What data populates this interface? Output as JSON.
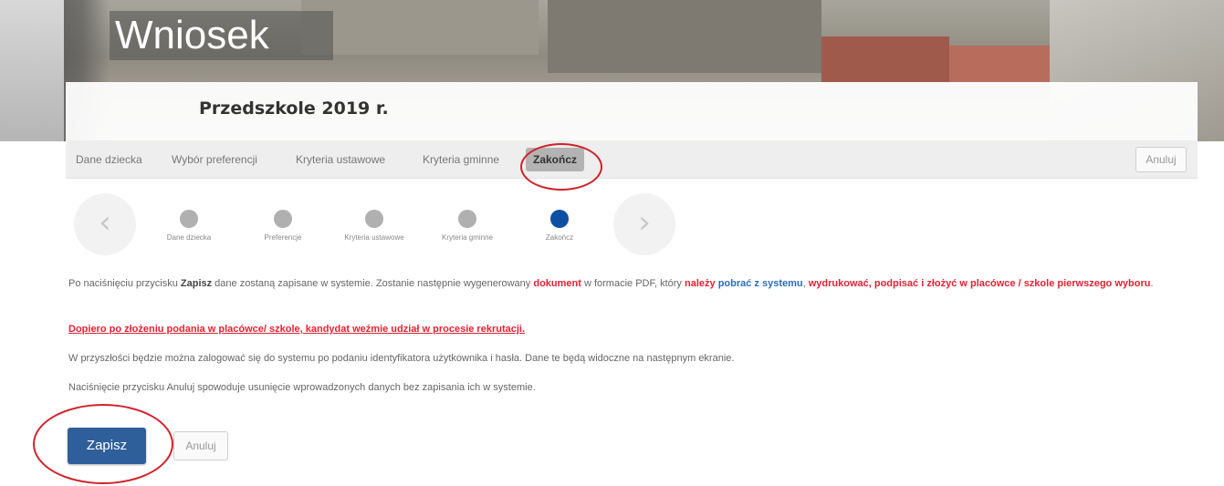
{
  "header": {
    "title": "Wniosek",
    "subtitle": "Przedszkole 2019 r."
  },
  "tabs": [
    {
      "label": "Dane dziecka"
    },
    {
      "label": "Wybór preferencji"
    },
    {
      "label": "Kryteria ustawowe"
    },
    {
      "label": "Kryteria gminne"
    },
    {
      "label": "Zakończ"
    }
  ],
  "active_tab": "Zakończ",
  "cancel_label": "Anuluj",
  "stepper": {
    "prev_icon": "chevron-left-icon",
    "next_icon": "chevron-right-icon",
    "steps": [
      {
        "label": "Dane dziecka"
      },
      {
        "label": "Preferencje"
      },
      {
        "label": "Kryteria ustawowe"
      },
      {
        "label": "Kryteria gminne"
      },
      {
        "label": "Zakończ"
      }
    ],
    "active_color": "#0d4fa3"
  },
  "content": {
    "p1_a": "Po naciśnięciu przycisku ",
    "p1_b": "Zapisz",
    "p1_c": " dane zostaną zapisane w systemie. Zostanie następnie wygenerowany ",
    "p1_d": "dokument",
    "p1_e": " w formacie PDF, który ",
    "p1_f": "należy",
    "p1_g": " ",
    "p1_h": "pobrać z systemu",
    "p1_i": ", ",
    "p1_j": "wydrukować, podpisać i złożyć w placówce / szkole pierwszego wyboru",
    "p1_k": ".",
    "p2": "Dopiero po złożeniu podania w placówce/ szkole, kandydat weźmie udział w procesie rekrutacji.",
    "p3": "W przyszłości będzie można zalogować się do systemu po podaniu identyfikatora użytkownika i hasła. Dane te będą widoczne na następnym ekranie.",
    "p4": "Naciśnięcie przycisku Anuluj spowoduje usunięcie wprowadzonych danych bez zapisania ich w systemie."
  },
  "actions": {
    "save_label": "Zapisz",
    "cancel_label": "Anuluj"
  },
  "colors": {
    "primary_button": "#2f5f9a",
    "highlight_red": "#e52233",
    "link_blue": "#2a6ebb",
    "annotation_ring": "#d0222a"
  }
}
